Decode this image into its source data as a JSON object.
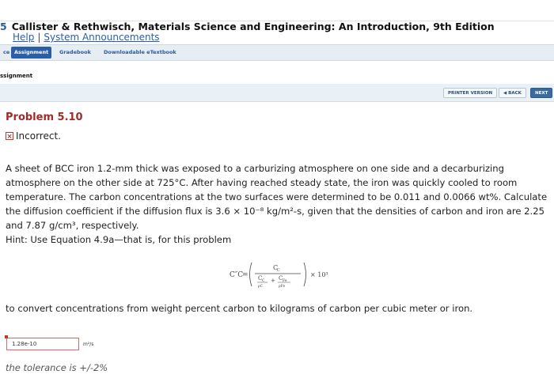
{
  "course": {
    "logo_mark": "5",
    "title": "Callister & Rethwisch, Materials Science and Engineering: An Introduction, 9th Edition"
  },
  "help_links": {
    "help": "Help",
    "separator": "|",
    "announcements": "System Announcements"
  },
  "tabs": [
    {
      "label": "ce"
    },
    {
      "label": "Assignment"
    },
    {
      "label": "Gradebook"
    },
    {
      "label": "Downloadable eTextbook"
    }
  ],
  "assignment_header": "ssignment",
  "nav_buttons": {
    "printer": "PRINTER VERSION",
    "back": "◀ BACK",
    "next": "NEXT"
  },
  "problem": {
    "title": "Problem 5.10",
    "status": "Incorrect.",
    "text": "A sheet of BCC iron 1.2-mm thick was exposed to a carburizing atmosphere on one side and a decarburizing atmosphere on the other side at 725°C. After having reached steady state, the iron was quickly cooled to room temperature. The carbon concentrations at the two surfaces were determined to be 0.011 and 0.0066 wt%. Calculate the diffusion coefficient if the diffusion flux is 3.6 × 10⁻⁸ kg/m²-s, given that the densities of carbon and iron are 2.25 and 7.87 g/cm³, respectively.",
    "hint": "Hint: Use Equation 4.9a—that is, for this problem",
    "convert": "to convert concentrations from weight percent carbon to kilograms of carbon per cubic meter or iron."
  },
  "equation": {
    "lhs": "C″C",
    "eq": "=",
    "num": "C",
    "num_sub": "C",
    "den1": "C",
    "den1_sub": "C",
    "den1_rho": "ρC",
    "den2": "C",
    "den2_sub": "Fe",
    "den2_rho": "ρFe",
    "plus": "+",
    "times": "× 10³"
  },
  "answer": {
    "value": "1.28e-10",
    "unit": "m²/s"
  },
  "tolerance": "the tolerance is +/-2%",
  "colors": {
    "accent": "#2a5fa8",
    "error": "#c0392b",
    "problem_title": "#a12a2a"
  }
}
